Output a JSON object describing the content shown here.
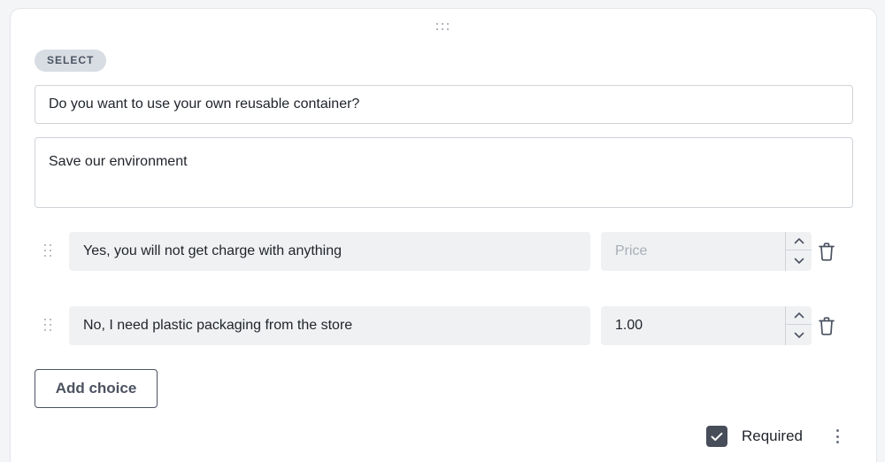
{
  "block": {
    "type_label": "SELECT",
    "question": "Do you want to use your own reusable container?",
    "description": "Save our environment"
  },
  "choices": [
    {
      "label": "Yes, you will not get charge with anything",
      "price": "",
      "price_placeholder": "Price"
    },
    {
      "label": "No, I need plastic packaging from the store",
      "price": "1.00",
      "price_placeholder": "Price"
    }
  ],
  "actions": {
    "add_choice_label": "Add choice"
  },
  "footer": {
    "required_label": "Required",
    "required_checked": true
  },
  "icons": {
    "drag": "drag-handle-icon",
    "trash": "trash-icon",
    "chevron_up": "chevron-up-icon",
    "chevron_down": "chevron-down-icon",
    "check": "check-icon",
    "more": "more-vertical-icon"
  },
  "colors": {
    "badge_bg": "#d8dce3",
    "checkbox_bg": "#474d59",
    "input_bg": "#f0f1f3",
    "border": "#cfd3d9"
  }
}
